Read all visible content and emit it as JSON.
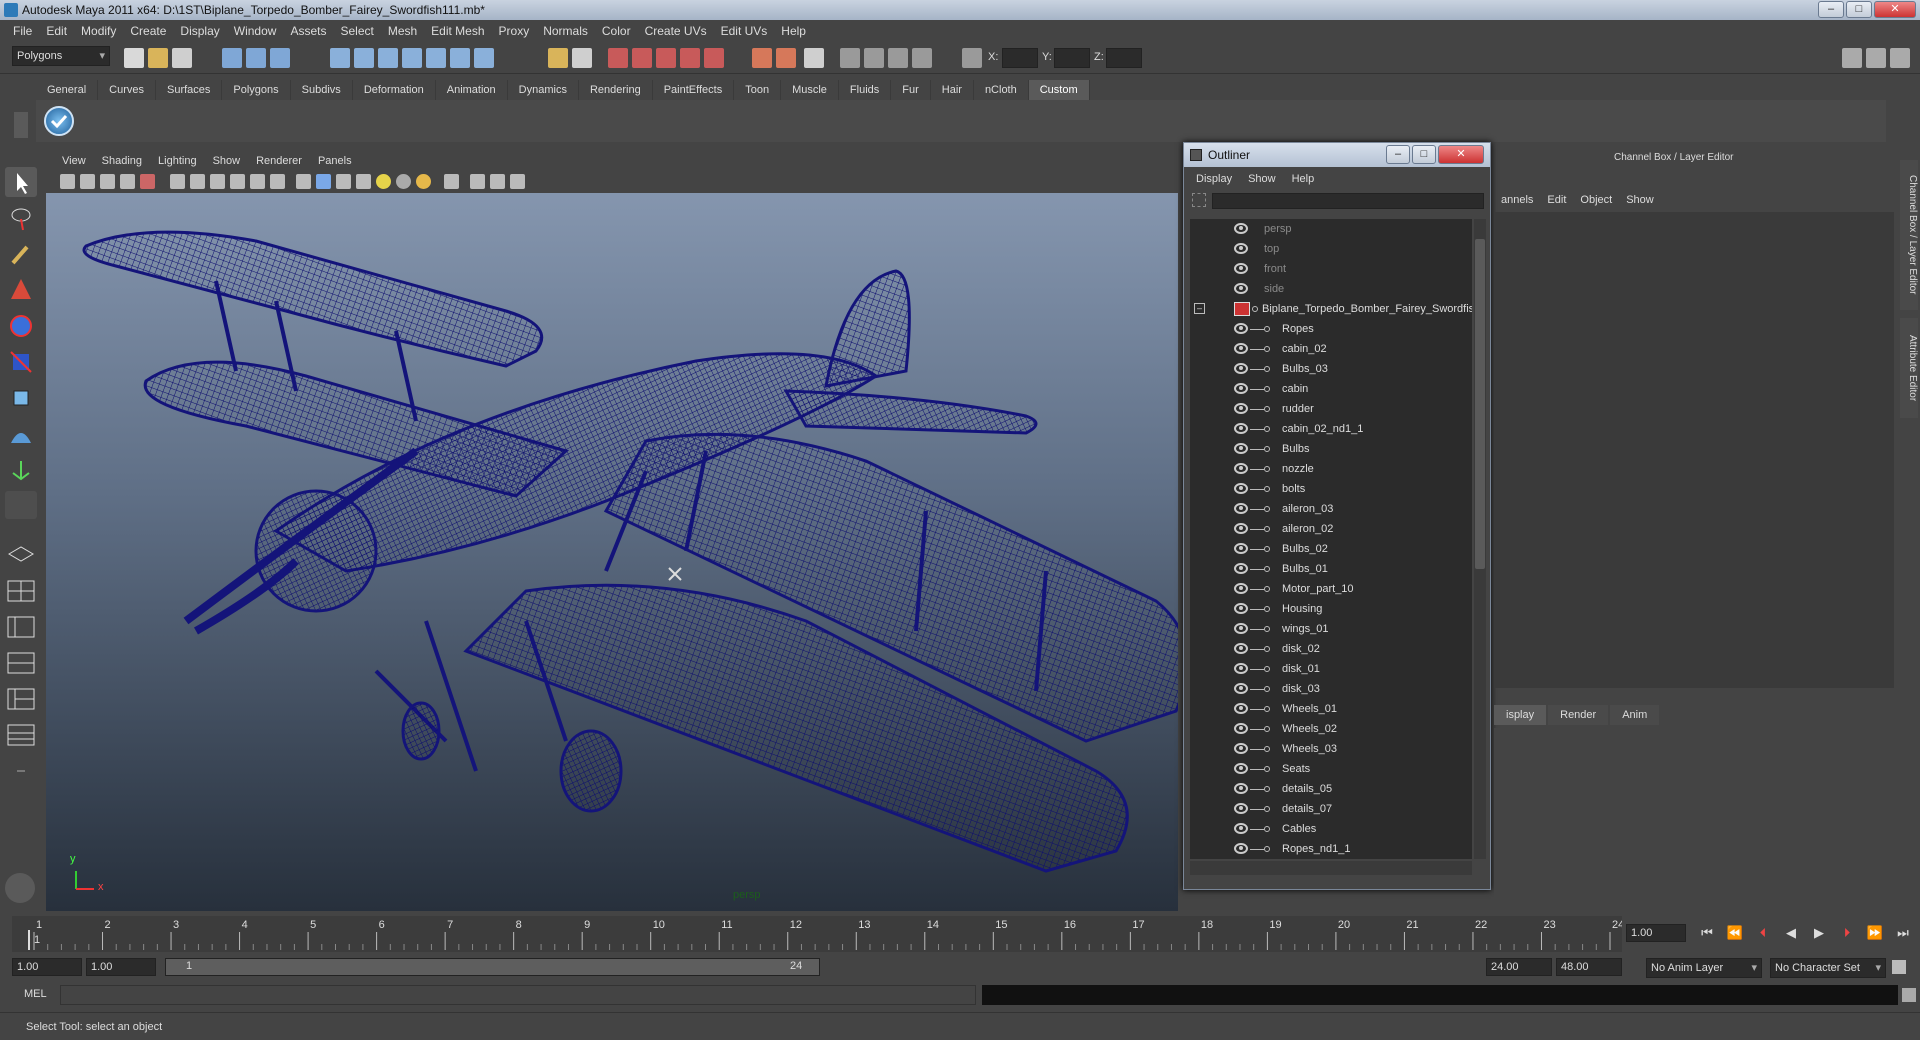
{
  "window": {
    "title": "Autodesk Maya 2011 x64: D:\\1ST\\Biplane_Torpedo_Bomber_Fairey_Swordfish111.mb*",
    "min": "–",
    "max": "□",
    "close": "✕"
  },
  "menubar": [
    "File",
    "Edit",
    "Modify",
    "Create",
    "Display",
    "Window",
    "Assets",
    "Select",
    "Mesh",
    "Edit Mesh",
    "Proxy",
    "Normals",
    "Color",
    "Create UVs",
    "Edit UVs",
    "Help"
  ],
  "statusline": {
    "mode": "Polygons",
    "x_label": "X:",
    "y_label": "Y:",
    "z_label": "Z:"
  },
  "shelf_tabs": [
    "General",
    "Curves",
    "Surfaces",
    "Polygons",
    "Subdivs",
    "Deformation",
    "Animation",
    "Dynamics",
    "Rendering",
    "PaintEffects",
    "Toon",
    "Muscle",
    "Fluids",
    "Fur",
    "Hair",
    "nCloth",
    "Custom"
  ],
  "shelf_active": "Custom",
  "viewport": {
    "menu": [
      "View",
      "Shading",
      "Lighting",
      "Show",
      "Renderer",
      "Panels"
    ],
    "camera_label": "persp",
    "axis_y": "y",
    "axis_x": "x"
  },
  "outliner": {
    "title": "Outliner",
    "menu": [
      "Display",
      "Show",
      "Help"
    ],
    "cameras": [
      "persp",
      "top",
      "front",
      "side"
    ],
    "root": "Biplane_Torpedo_Bomber_Fairey_Swordfis",
    "children": [
      "Ropes",
      "cabin_02",
      "Bulbs_03",
      "cabin",
      "rudder",
      "cabin_02_nd1_1",
      "Bulbs",
      "nozzle",
      "bolts",
      "aileron_03",
      "aileron_02",
      "Bulbs_02",
      "Bulbs_01",
      "Motor_part_10",
      "Housing",
      "wings_01",
      "disk_02",
      "disk_01",
      "disk_03",
      "Wheels_01",
      "Wheels_02",
      "Wheels_03",
      "Seats",
      "details_05",
      "details_07",
      "Cables",
      "Ropes_nd1_1"
    ]
  },
  "channel_box": {
    "title": "Channel Box / Layer Editor",
    "menu": [
      "annels",
      "Edit",
      "Object",
      "Show"
    ],
    "layer_tabs": [
      "isplay",
      "Render",
      "Anim"
    ],
    "side_tabs": [
      "Channel Box / Layer Editor",
      "Attribute Editor"
    ]
  },
  "timeline": {
    "ticks": [
      1,
      2,
      3,
      4,
      5,
      6,
      7,
      8,
      9,
      10,
      11,
      12,
      13,
      14,
      15,
      16,
      17,
      18,
      19,
      20,
      21,
      22,
      23,
      24
    ],
    "current_frame": "1.00",
    "cursor_label": "1"
  },
  "range": {
    "start": "1.00",
    "playback_start": "1.00",
    "slider_start": "1",
    "slider_end": "24",
    "playback_end": "24.00",
    "end": "48.00",
    "anim_layer": "No Anim Layer",
    "char_set": "No Character Set"
  },
  "mel": {
    "label": "MEL"
  },
  "help": {
    "text": "Select Tool: select an object"
  },
  "colors": {
    "wire": "#15157a",
    "bg_top": "#8a9bb4",
    "bg_bottom": "#27303c"
  }
}
